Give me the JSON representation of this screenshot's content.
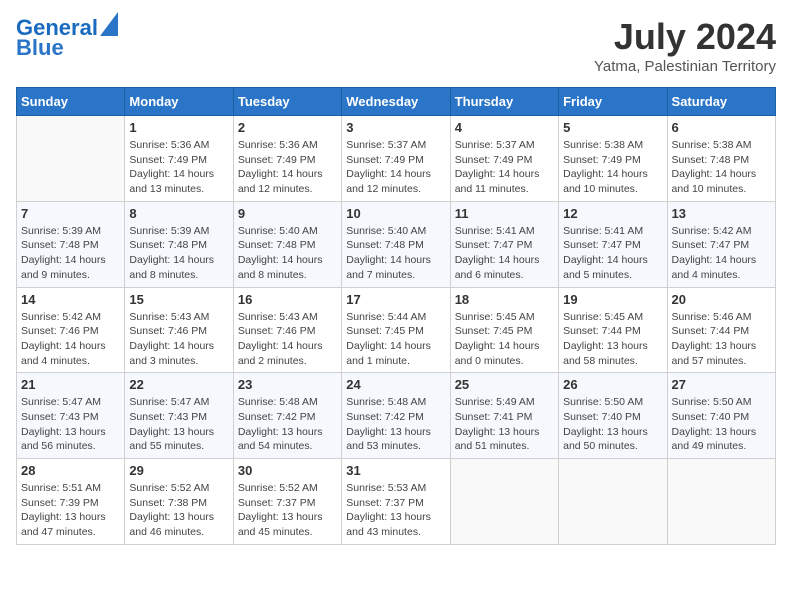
{
  "logo": {
    "line1": "General",
    "line2": "Blue"
  },
  "title": "July 2024",
  "location": "Yatma, Palestinian Territory",
  "headers": [
    "Sunday",
    "Monday",
    "Tuesday",
    "Wednesday",
    "Thursday",
    "Friday",
    "Saturday"
  ],
  "weeks": [
    [
      {
        "day": "",
        "sunrise": "",
        "sunset": "",
        "daylight": ""
      },
      {
        "day": "1",
        "sunrise": "Sunrise: 5:36 AM",
        "sunset": "Sunset: 7:49 PM",
        "daylight": "Daylight: 14 hours and 13 minutes."
      },
      {
        "day": "2",
        "sunrise": "Sunrise: 5:36 AM",
        "sunset": "Sunset: 7:49 PM",
        "daylight": "Daylight: 14 hours and 12 minutes."
      },
      {
        "day": "3",
        "sunrise": "Sunrise: 5:37 AM",
        "sunset": "Sunset: 7:49 PM",
        "daylight": "Daylight: 14 hours and 12 minutes."
      },
      {
        "day": "4",
        "sunrise": "Sunrise: 5:37 AM",
        "sunset": "Sunset: 7:49 PM",
        "daylight": "Daylight: 14 hours and 11 minutes."
      },
      {
        "day": "5",
        "sunrise": "Sunrise: 5:38 AM",
        "sunset": "Sunset: 7:49 PM",
        "daylight": "Daylight: 14 hours and 10 minutes."
      },
      {
        "day": "6",
        "sunrise": "Sunrise: 5:38 AM",
        "sunset": "Sunset: 7:48 PM",
        "daylight": "Daylight: 14 hours and 10 minutes."
      }
    ],
    [
      {
        "day": "7",
        "sunrise": "Sunrise: 5:39 AM",
        "sunset": "Sunset: 7:48 PM",
        "daylight": "Daylight: 14 hours and 9 minutes."
      },
      {
        "day": "8",
        "sunrise": "Sunrise: 5:39 AM",
        "sunset": "Sunset: 7:48 PM",
        "daylight": "Daylight: 14 hours and 8 minutes."
      },
      {
        "day": "9",
        "sunrise": "Sunrise: 5:40 AM",
        "sunset": "Sunset: 7:48 PM",
        "daylight": "Daylight: 14 hours and 8 minutes."
      },
      {
        "day": "10",
        "sunrise": "Sunrise: 5:40 AM",
        "sunset": "Sunset: 7:48 PM",
        "daylight": "Daylight: 14 hours and 7 minutes."
      },
      {
        "day": "11",
        "sunrise": "Sunrise: 5:41 AM",
        "sunset": "Sunset: 7:47 PM",
        "daylight": "Daylight: 14 hours and 6 minutes."
      },
      {
        "day": "12",
        "sunrise": "Sunrise: 5:41 AM",
        "sunset": "Sunset: 7:47 PM",
        "daylight": "Daylight: 14 hours and 5 minutes."
      },
      {
        "day": "13",
        "sunrise": "Sunrise: 5:42 AM",
        "sunset": "Sunset: 7:47 PM",
        "daylight": "Daylight: 14 hours and 4 minutes."
      }
    ],
    [
      {
        "day": "14",
        "sunrise": "Sunrise: 5:42 AM",
        "sunset": "Sunset: 7:46 PM",
        "daylight": "Daylight: 14 hours and 4 minutes."
      },
      {
        "day": "15",
        "sunrise": "Sunrise: 5:43 AM",
        "sunset": "Sunset: 7:46 PM",
        "daylight": "Daylight: 14 hours and 3 minutes."
      },
      {
        "day": "16",
        "sunrise": "Sunrise: 5:43 AM",
        "sunset": "Sunset: 7:46 PM",
        "daylight": "Daylight: 14 hours and 2 minutes."
      },
      {
        "day": "17",
        "sunrise": "Sunrise: 5:44 AM",
        "sunset": "Sunset: 7:45 PM",
        "daylight": "Daylight: 14 hours and 1 minute."
      },
      {
        "day": "18",
        "sunrise": "Sunrise: 5:45 AM",
        "sunset": "Sunset: 7:45 PM",
        "daylight": "Daylight: 14 hours and 0 minutes."
      },
      {
        "day": "19",
        "sunrise": "Sunrise: 5:45 AM",
        "sunset": "Sunset: 7:44 PM",
        "daylight": "Daylight: 13 hours and 58 minutes."
      },
      {
        "day": "20",
        "sunrise": "Sunrise: 5:46 AM",
        "sunset": "Sunset: 7:44 PM",
        "daylight": "Daylight: 13 hours and 57 minutes."
      }
    ],
    [
      {
        "day": "21",
        "sunrise": "Sunrise: 5:47 AM",
        "sunset": "Sunset: 7:43 PM",
        "daylight": "Daylight: 13 hours and 56 minutes."
      },
      {
        "day": "22",
        "sunrise": "Sunrise: 5:47 AM",
        "sunset": "Sunset: 7:43 PM",
        "daylight": "Daylight: 13 hours and 55 minutes."
      },
      {
        "day": "23",
        "sunrise": "Sunrise: 5:48 AM",
        "sunset": "Sunset: 7:42 PM",
        "daylight": "Daylight: 13 hours and 54 minutes."
      },
      {
        "day": "24",
        "sunrise": "Sunrise: 5:48 AM",
        "sunset": "Sunset: 7:42 PM",
        "daylight": "Daylight: 13 hours and 53 minutes."
      },
      {
        "day": "25",
        "sunrise": "Sunrise: 5:49 AM",
        "sunset": "Sunset: 7:41 PM",
        "daylight": "Daylight: 13 hours and 51 minutes."
      },
      {
        "day": "26",
        "sunrise": "Sunrise: 5:50 AM",
        "sunset": "Sunset: 7:40 PM",
        "daylight": "Daylight: 13 hours and 50 minutes."
      },
      {
        "day": "27",
        "sunrise": "Sunrise: 5:50 AM",
        "sunset": "Sunset: 7:40 PM",
        "daylight": "Daylight: 13 hours and 49 minutes."
      }
    ],
    [
      {
        "day": "28",
        "sunrise": "Sunrise: 5:51 AM",
        "sunset": "Sunset: 7:39 PM",
        "daylight": "Daylight: 13 hours and 47 minutes."
      },
      {
        "day": "29",
        "sunrise": "Sunrise: 5:52 AM",
        "sunset": "Sunset: 7:38 PM",
        "daylight": "Daylight: 13 hours and 46 minutes."
      },
      {
        "day": "30",
        "sunrise": "Sunrise: 5:52 AM",
        "sunset": "Sunset: 7:37 PM",
        "daylight": "Daylight: 13 hours and 45 minutes."
      },
      {
        "day": "31",
        "sunrise": "Sunrise: 5:53 AM",
        "sunset": "Sunset: 7:37 PM",
        "daylight": "Daylight: 13 hours and 43 minutes."
      },
      {
        "day": "",
        "sunrise": "",
        "sunset": "",
        "daylight": ""
      },
      {
        "day": "",
        "sunrise": "",
        "sunset": "",
        "daylight": ""
      },
      {
        "day": "",
        "sunrise": "",
        "sunset": "",
        "daylight": ""
      }
    ]
  ]
}
